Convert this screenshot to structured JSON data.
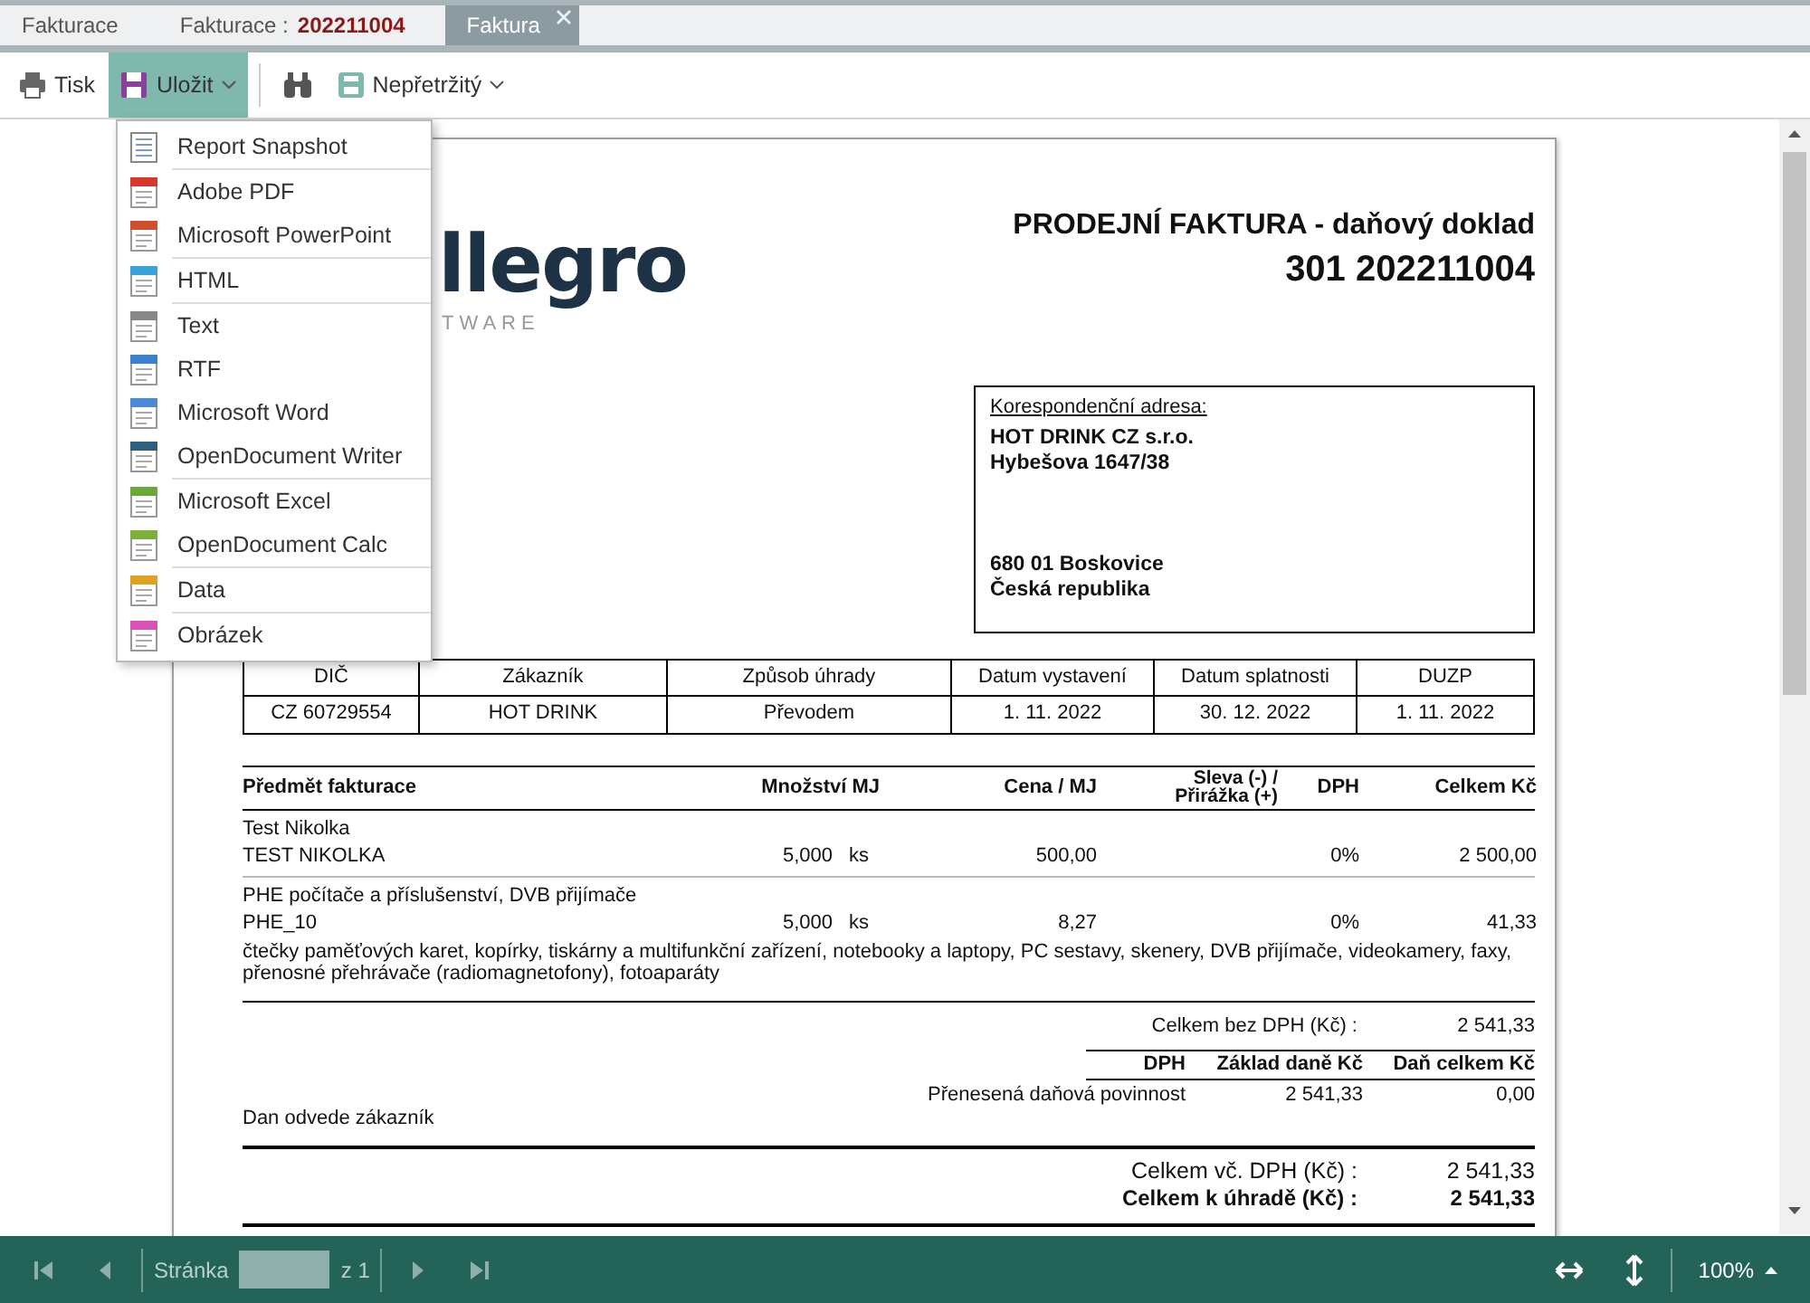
{
  "tabs": [
    {
      "label": "Fakturace",
      "selected": false
    },
    {
      "label": "Fakturace :",
      "number": "202211004",
      "selected": false
    },
    {
      "label": "Faktura",
      "selected": true
    }
  ],
  "toolbar": [
    {
      "kind": "print",
      "label": "Tisk"
    },
    {
      "kind": "save",
      "label": "Uložit",
      "dropdown": true,
      "open": true
    },
    {
      "kind": "find"
    },
    {
      "kind": "continuous",
      "label": "Nepřetržitý",
      "dropdown": true,
      "open": false
    }
  ],
  "save_menu": [
    [
      {
        "label": "Report Snapshot"
      }
    ],
    [
      {
        "label": "Adobe PDF",
        "color": "#d9362b"
      },
      {
        "label": "Microsoft PowerPoint",
        "color": "#d24f2d"
      }
    ],
    [
      {
        "label": "HTML",
        "color": "#3aa3d8"
      }
    ],
    [
      {
        "label": "Text",
        "color": "#888888"
      },
      {
        "label": "RTF",
        "color": "#3b7fd0"
      },
      {
        "label": "Microsoft Word",
        "color": "#4a8ad8"
      },
      {
        "label": "OpenDocument Writer",
        "color": "#2f5f7a"
      }
    ],
    [
      {
        "label": "Microsoft Excel",
        "color": "#6aa83a"
      },
      {
        "label": "OpenDocument Calc",
        "color": "#7bb03a"
      }
    ],
    [
      {
        "label": "Data",
        "color": "#e0a020"
      }
    ],
    [
      {
        "label": "Obrázek",
        "color": "#d850b8"
      }
    ]
  ],
  "invoice": {
    "logo": {
      "name": "llegro",
      "tagline": "TWARE"
    },
    "title": "PRODEJNÍ FAKTURA - daňový doklad",
    "number": "301 202211004",
    "address": {
      "heading": "Korespondenční adresa:",
      "lines_top": [
        "HOT DRINK CZ s.r.o.",
        "Hybešova 1647/38"
      ],
      "lines_bottom": [
        "680 01  Boskovice",
        "Česká republika"
      ]
    },
    "info_table": {
      "columns": [
        "DIČ",
        "Zákazník",
        "Způsob úhrady",
        "Datum vystavení",
        "Datum splatnosti",
        "DUZP"
      ],
      "row": [
        "CZ 60729554",
        "HOT DRINK",
        "Převodem",
        "1. 11. 2022",
        "30. 12. 2022",
        "1. 11. 2022"
      ]
    },
    "items_columns": [
      "Předmět fakturace",
      "Množství MJ",
      "Cena / MJ",
      "Sleva (-) / Přirážka (+)",
      "DPH",
      "Celkem Kč"
    ],
    "items": [
      {
        "group": "Test Nikolka",
        "code": "TEST NIKOLKA",
        "quantity": "5,000",
        "unit": "ks",
        "price": "500,00",
        "vat": "0%",
        "total": "2 500,00"
      },
      {
        "group": "PHE počítače a příslušenství, DVB přijímače",
        "code": "PHE_10",
        "quantity": "5,000",
        "unit": "ks",
        "price": "8,27",
        "vat": "0%",
        "total": "41,33",
        "description": "čtečky paměťových karet, kopírky, tiskárny a multifunkční zařízení, notebooky a laptopy, PC sestavy, skenery, DVB přijímače, videokamery, faxy, přenosné přehrávače (radiomagnetofony), fotoaparáty"
      }
    ],
    "subtotal": {
      "label": "Celkem bez DPH (Kč) :",
      "value": "2 541,33"
    },
    "vat_table": {
      "columns": [
        "DPH",
        "Základ daně Kč",
        "Daň celkem Kč"
      ],
      "row": [
        "Přenesená daňová povinnost",
        "2 541,33",
        "0,00"
      ]
    },
    "note": "Dan odvede zákazník",
    "totals": [
      {
        "label": "Celkem vč. DPH (Kč) :",
        "value": "2 541,33",
        "bold": false
      },
      {
        "label": "Celkem k úhradě (Kč) :",
        "value": "2 541,33",
        "bold": true
      }
    ]
  },
  "pager": {
    "label": "Stránka",
    "of": "z 1",
    "zoom": "100%"
  }
}
